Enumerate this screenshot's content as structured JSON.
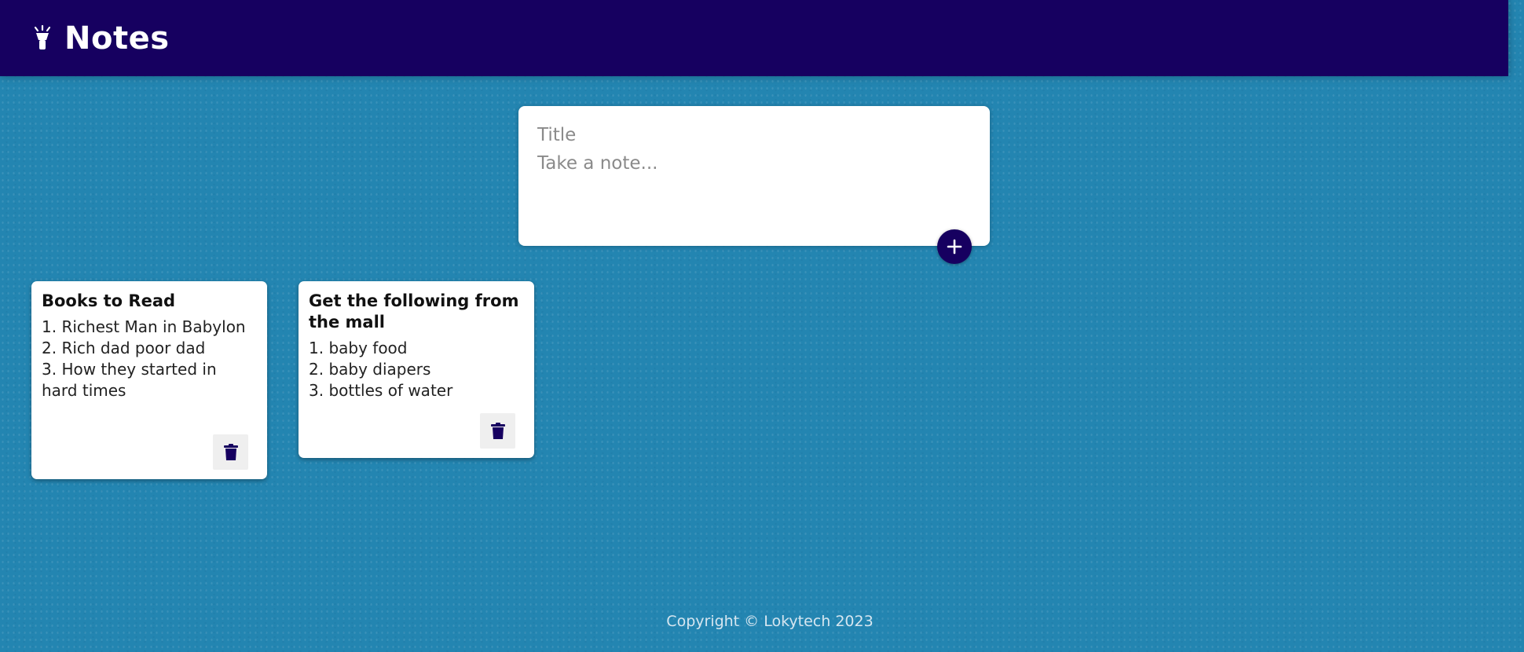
{
  "header": {
    "title": "Notes",
    "icon": "lightbulb-icon"
  },
  "composer": {
    "title_placeholder": "Title",
    "content_placeholder": "Take a note...",
    "add_icon": "plus-icon"
  },
  "notes": [
    {
      "title": "Books to Read",
      "content": "1. Richest Man in Babylon\n2. Rich dad poor dad\n3. How they started in hard times",
      "delete_icon": "trash-icon"
    },
    {
      "title": "Get the following from the mall",
      "content": "1. baby food\n2. baby diapers\n3. bottles of water",
      "delete_icon": "trash-icon"
    }
  ],
  "footer": {
    "text": "Copyright © Lokytech 2023"
  },
  "colors": {
    "header_bg": "#160060",
    "page_bg": "#2385b1",
    "accent": "#160060"
  }
}
